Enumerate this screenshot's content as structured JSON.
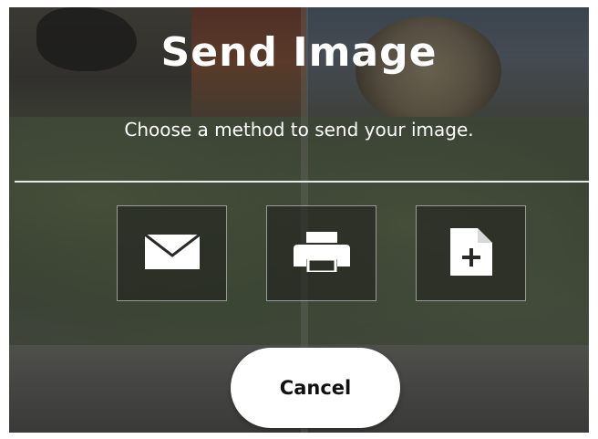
{
  "dialog": {
    "title": "Send Image",
    "subtitle": "Choose a method to send your image."
  },
  "options": [
    {
      "name": "email",
      "icon": "envelope-icon"
    },
    {
      "name": "print",
      "icon": "printer-icon"
    },
    {
      "name": "new-document",
      "icon": "new-document-icon"
    }
  ],
  "buttons": {
    "cancel_label": "Cancel"
  },
  "colors": {
    "text": "#ffffff",
    "separator": "#e8e8e8",
    "cancel_bg": "#ffffff",
    "cancel_text": "#111111"
  }
}
